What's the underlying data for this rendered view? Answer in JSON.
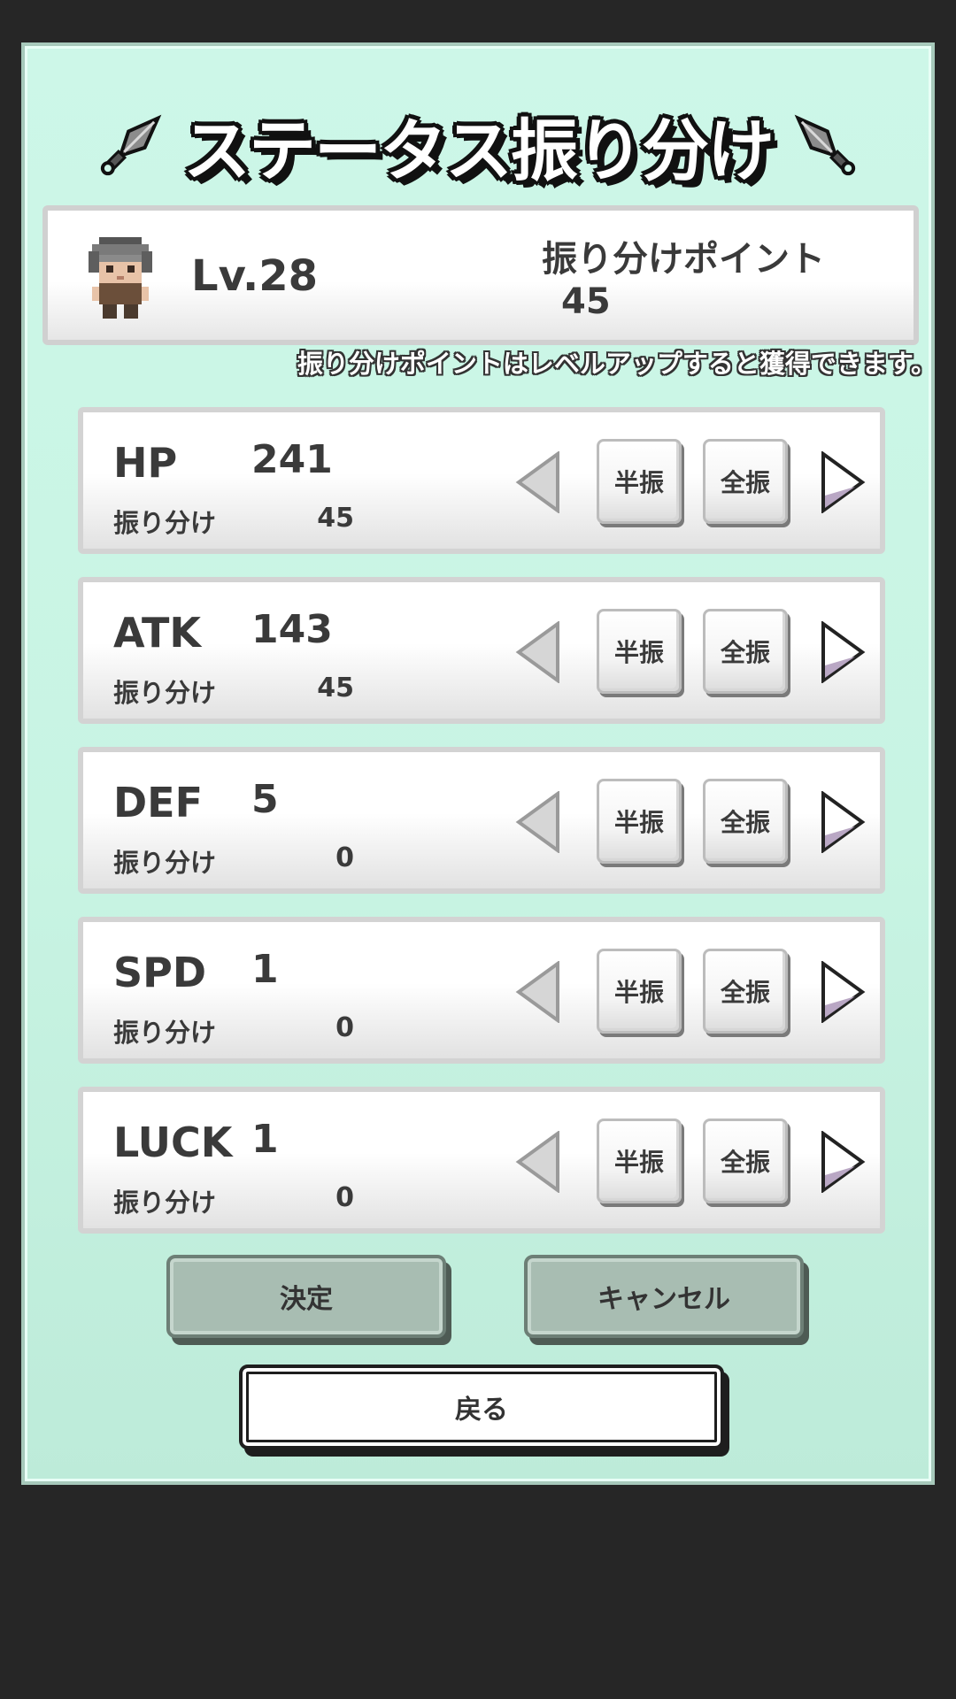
{
  "title": "ステータス振り分け",
  "player": {
    "level": "Lv.28",
    "points_label": "振り分けポイント",
    "points_value": "45"
  },
  "hint": "振り分けポイントはレベルアップすると獲得できます。",
  "stats": [
    {
      "name": "HP",
      "value": "241",
      "alloc_label": "振り分け",
      "alloc": "45"
    },
    {
      "name": "ATK",
      "value": "143",
      "alloc_label": "振り分け",
      "alloc": "45"
    },
    {
      "name": "DEF",
      "value": "5",
      "alloc_label": "振り分け",
      "alloc": "0"
    },
    {
      "name": "SPD",
      "value": "1",
      "alloc_label": "振り分け",
      "alloc": "0"
    },
    {
      "name": "LUCK",
      "value": "1",
      "alloc_label": "振り分け",
      "alloc": "0"
    }
  ],
  "buttons": {
    "half": "半振",
    "full": "全振",
    "decide": "決定",
    "cancel": "キャンセル",
    "back": "戻る"
  },
  "icons": {
    "title_decoration": "kunai-icon",
    "decrease": "triangle-left-icon",
    "increase": "triangle-right-icon",
    "avatar": "character-sprite"
  },
  "colors": {
    "background": "#262626",
    "panel": "#cdf7e8",
    "action_button": "#a8bdb2"
  }
}
